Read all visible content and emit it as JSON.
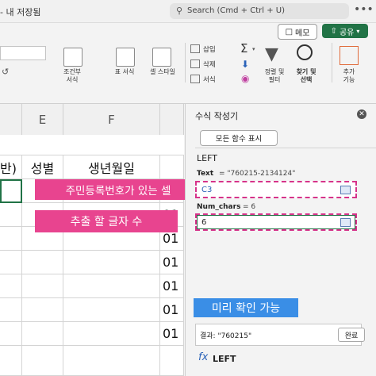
{
  "topbar": {
    "title": "- 내 저장됨",
    "search_placeholder": "Search (Cmd + Ctrl + U)",
    "more": "•••"
  },
  "header_buttons": {
    "memo": "메모",
    "share": "공유"
  },
  "ribbon": {
    "conditional_format": [
      "조건부",
      "서식"
    ],
    "table_format": "표 서식",
    "cell_style": "셀 스타일",
    "insert": "삽입",
    "delete": "삭제",
    "format": "서식",
    "sort_filter": [
      "정렬 및",
      "필터"
    ],
    "find_select": [
      "찾기 및",
      "선택"
    ],
    "addins": [
      "추가",
      "기능"
    ]
  },
  "grid": {
    "columns": [
      "E",
      "F"
    ],
    "header_row": [
      "반)",
      "성별",
      "생년월일"
    ],
    "col_f_values": [
      "01",
      "01",
      "01",
      "01",
      "01",
      "01",
      "01"
    ]
  },
  "overlays": {
    "label1": "주민등록번호가 있는 셀",
    "label2": "추출 할 글자 수",
    "label3": "미리 확인 가능"
  },
  "panel": {
    "title": "수식 작성기",
    "show_all": "모든 함수 표시",
    "function_name": "LEFT",
    "text_label": "Text",
    "text_preview": "= \"760215-2134124\"",
    "text_value": "C3",
    "num_label": "Num_chars",
    "num_preview": "= 6",
    "num_value": "6",
    "result_text": "결과: \"760215\"",
    "done": "완료",
    "fx_symbol": "fx",
    "fx_name": "LEFT"
  },
  "colors": {
    "accent": "#e8448f",
    "excel_green": "#217346",
    "field_dashed": "#d6338a"
  }
}
